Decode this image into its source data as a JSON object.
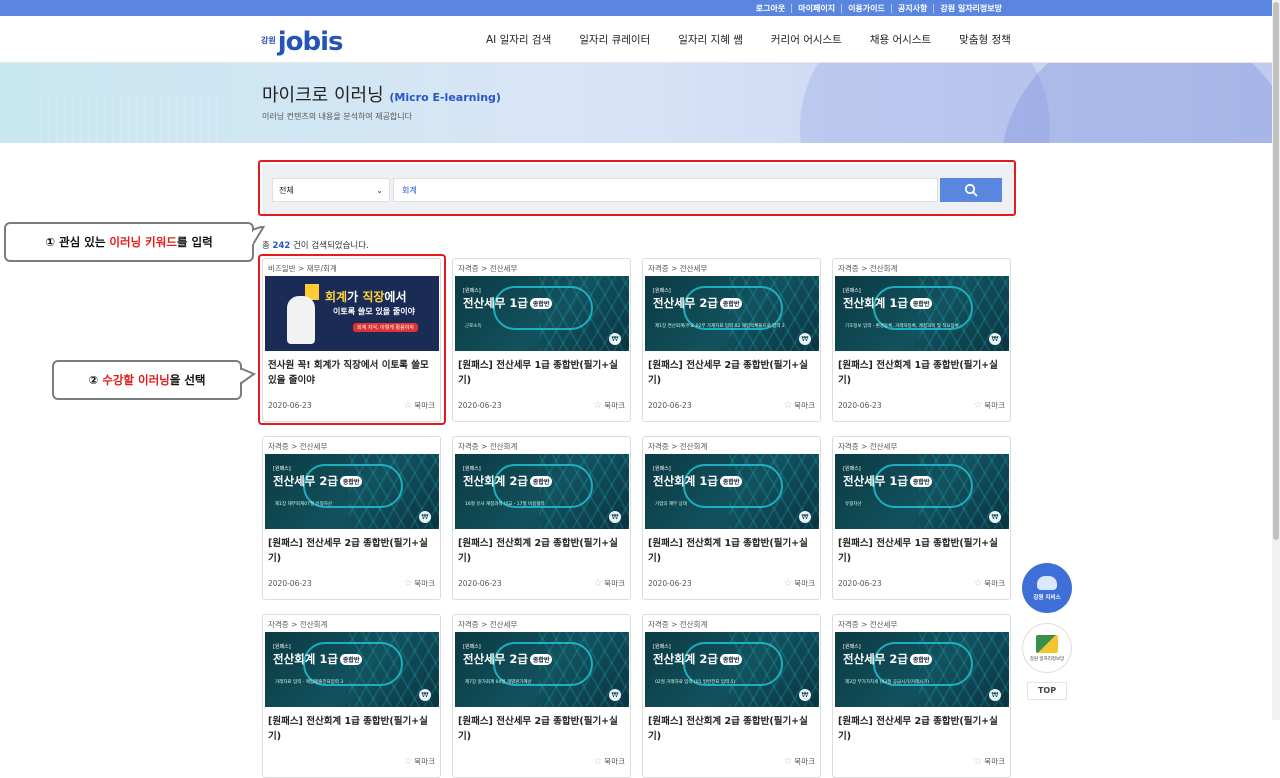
{
  "util_links": [
    "로그아웃",
    "마이페이지",
    "이용가이드",
    "공지사항",
    "강원 일자리정보망"
  ],
  "logo": {
    "small": "강원",
    "main": "jobis"
  },
  "nav": [
    "AI 일자리 검색",
    "일자리 큐레이터",
    "일자리 지혜 쌤",
    "커리어 어시스트",
    "채용 어시스트",
    "맞춤형 정책"
  ],
  "hero": {
    "title": "마이크로 이러닝",
    "title_en": "(Micro E-learning)",
    "subtitle": "이러닝 컨텐츠의 내용을 분석하여 제공합니다"
  },
  "search": {
    "select_value": "전체",
    "query": "회계"
  },
  "result": {
    "prefix": "총",
    "count": "242",
    "suffix": "건이 검색되었습니다."
  },
  "callouts": {
    "c1": {
      "num": "①",
      "pre": " 관심 있는 ",
      "hl": "이러닝 키워드",
      "post": "를 입력"
    },
    "c2": {
      "num": "②",
      "pre": " ",
      "hl": "수강할 이러닝",
      "post": "을 선택"
    }
  },
  "bookmark_label": "북마크",
  "special_thumb": {
    "big_a": "회계",
    "big_b": "가 ",
    "big_c": "직장",
    "big_d": "에서",
    "mid": "이토록 쓸모 있을 줄이야",
    "small": "회계 지식, 이렇게 활용하자"
  },
  "cards": [
    {
      "cat": "비즈일반 > 재무/회계",
      "thumb_title": "",
      "thumb_sub": "",
      "title": "전사원 꼭! 회계가 직장에서 이토록 쓸모 있을 줄이야",
      "date": "2020-06-23"
    },
    {
      "cat": "자격증 > 전산세무",
      "thumb_title": "전산세무 1급",
      "thumb_sub": "근로소득",
      "title": "[원패스] 전산세무 1급 종합반(필기+실기)",
      "date": "2020-06-23"
    },
    {
      "cat": "자격증 > 전산세무",
      "thumb_title": "전산세무 2급",
      "thumb_sub": "제1장 연산회계(주요 02부 가계자료 입력 02 재입력체율으로 입력 2",
      "title": "[원패스] 전산세무 2급 종합반(필기+실기)",
      "date": "2020-06-23"
    },
    {
      "cat": "자격증 > 전산회계",
      "thumb_title": "전산회계 1급",
      "thumb_sub": "기초정보 입력 - 환경등록, 거래처등록, 계정과목 및 적요등록",
      "title": "[원패스] 전산회계 1급 종합반(필기+실기)",
      "date": "2020-06-23"
    },
    {
      "cat": "자격증 > 전산세무",
      "thumb_title": "전산세무 2급",
      "thumb_sub": "제1장 재무회계07절 유형자산",
      "title": "[원패스] 전산세무 2급 종합반(필기+실기)",
      "date": "2020-06-23"
    },
    {
      "cat": "자격증 > 전산회계",
      "thumb_title": "전산회계 2급",
      "thumb_sub": "16절 유사 계정과목 비교 - 17절 비용항목",
      "title": "[원패스] 전산회계 2급 종합반(필기+실기)",
      "date": "2020-06-23"
    },
    {
      "cat": "자격증 > 전산회계",
      "thumb_title": "전산회계 1급",
      "thumb_sub": "기업의 재무 상태",
      "title": "[원패스] 전산회계 1급 종합반(필기+실기)",
      "date": "2020-06-23"
    },
    {
      "cat": "자격증 > 전산세무",
      "thumb_title": "전산세무 1급",
      "thumb_sub": "유형자산",
      "title": "[원패스] 전산세무 1급 종합반(필기+실기)",
      "date": "2020-06-23"
    },
    {
      "cat": "자격증 > 전산회계",
      "thumb_title": "전산회계 1급",
      "thumb_sub": "거래자료 입력 - 매입매출전표입력 3",
      "title": "[원패스] 전산회계 1급 종합반(필기+실기)",
      "date": ""
    },
    {
      "cat": "자격증 > 전산세무",
      "thumb_title": "전산세무 2급",
      "thumb_sub": "제7장 원가회계 04절 개별원가계산",
      "title": "[원패스] 전산세무 2급 종합반(필기+실기)",
      "date": ""
    },
    {
      "cat": "자격증 > 전산회계",
      "thumb_title": "전산회계 2급",
      "thumb_sub": "02절 거래자료 입력 (01 일반전표 입력 5)",
      "title": "[원패스] 전산회계 2급 종합반(필기+실기)",
      "date": ""
    },
    {
      "cat": "자격증 > 전산세무",
      "thumb_title": "전산세무 2급",
      "thumb_sub": "제3장 부가가치세 (03절 공급시기/거래시기)",
      "title": "[원패스] 전산세무 2급 종합반(필기+실기)",
      "date": ""
    }
  ],
  "thumb_brand": "[원패스]",
  "thumb_pill": "종합반",
  "float": {
    "bot_label": "강원 지비스",
    "cal_label": "강원 일자리정보망",
    "top": "TOP"
  }
}
